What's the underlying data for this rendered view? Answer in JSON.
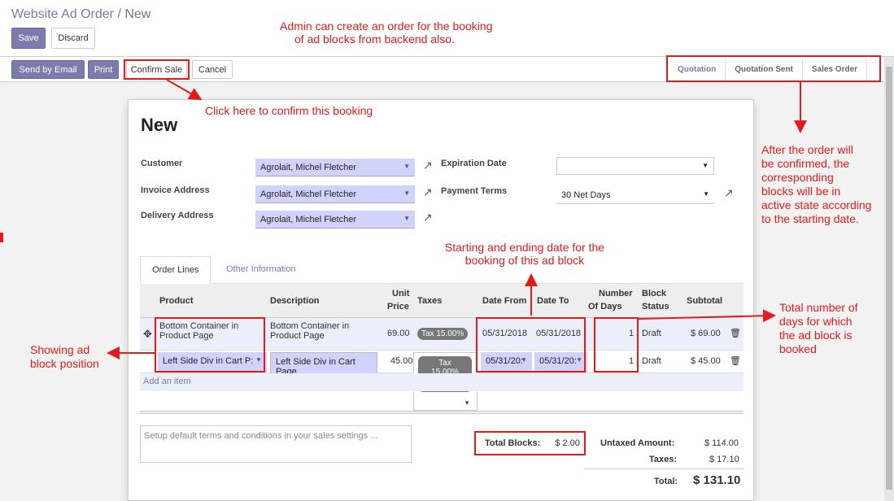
{
  "header": {
    "breadcrumb_parent": "Website Ad Order",
    "breadcrumb_sep": "/",
    "breadcrumb_current": "New",
    "save": "Save",
    "discard": "Discard"
  },
  "statusbar": {
    "send_email": "Send by Email",
    "print": "Print",
    "confirm": "Confirm Sale",
    "cancel": "Cancel",
    "stages": [
      "Quotation",
      "Quotation Sent",
      "Sales Order"
    ]
  },
  "form": {
    "title": "New",
    "customer_label": "Customer",
    "customer": "Agrolait, Michel Fletcher",
    "invoice_label": "Invoice Address",
    "invoice": "Agrolait, Michel Fletcher",
    "delivery_label": "Delivery Address",
    "delivery": "Agrolait, Michel Fletcher",
    "expiration_label": "Expiration Date",
    "expiration": "",
    "terms_label": "Payment Terms",
    "terms": "30 Net Days"
  },
  "tabs": [
    "Order Lines",
    "Other Information"
  ],
  "columns": {
    "product": "Product",
    "description": "Description",
    "unit": "Unit",
    "price": "Price",
    "taxes": "Taxes",
    "date_from": "Date From",
    "date_to": "Date To",
    "number": "Number",
    "of_days": "Of Days",
    "block": "Block",
    "status": "Status",
    "subtotal": "Subtotal"
  },
  "lines": [
    {
      "product": "Bottom Container in Product Page",
      "description": "Bottom Container in Product Page",
      "price": "69.00",
      "tax": "Tax 15.00%",
      "from": "05/31/2018",
      "to": "05/31/2018",
      "days": "1",
      "status": "Draft",
      "subtotal": "$ 69.00"
    },
    {
      "product": "Left Side Div in Cart P:",
      "description": "Left Side Div in Cart Page",
      "price": "45.00",
      "tax_l1": "Tax",
      "tax_l2": "15.00%",
      "tax_x": "✖",
      "from": "05/31/20:",
      "to": "05/31/20:",
      "days": "1",
      "status": "Draft",
      "subtotal": "$ 45.00"
    }
  ],
  "add_item": "Add an item",
  "terms_placeholder": "Setup default terms and conditions in your sales settings ...",
  "totals": {
    "blocks_label": "Total Blocks:",
    "blocks": "$ 2.00",
    "untaxed_label": "Untaxed Amount:",
    "untaxed": "$ 114.00",
    "taxes_label": "Taxes:",
    "taxes": "$ 17.10",
    "total_label": "Total:",
    "total": "$ 131.10"
  },
  "annotations": {
    "a1": "Admin can create an order for the booking",
    "a1b": "of ad blocks from backend also.",
    "a2": "Click here to confirm this booking",
    "a3": [
      "After the order will",
      "be confirmed, the",
      "corresponding",
      "blocks will be in",
      "active state according",
      "to the starting date."
    ],
    "a4": [
      "Starting and ending date for the",
      "booking of this ad block"
    ],
    "a5": [
      "Total number of",
      "days for which",
      "the ad block is",
      "booked"
    ],
    "a6": [
      "Showing ad",
      "block position"
    ]
  }
}
